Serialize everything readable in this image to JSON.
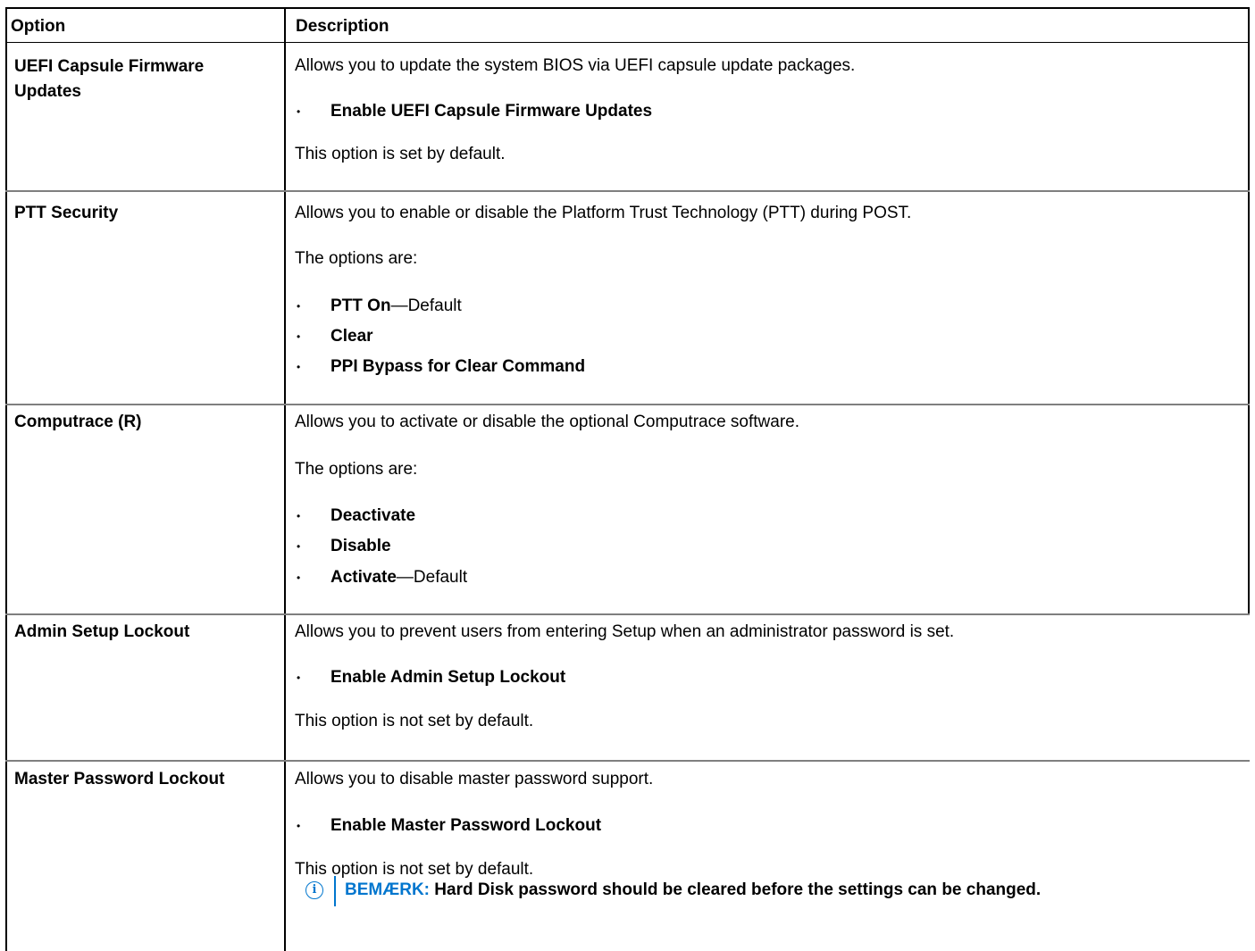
{
  "colors": {
    "note_accent": "#0076ce",
    "row_divider": "#7f7f7f"
  },
  "header": {
    "option": "Option",
    "description": "Description"
  },
  "rows": [
    {
      "option": "UEFI Capsule Firmware Updates",
      "lines": [
        "Allows you to update the system BIOS via UEFI capsule update packages.",
        "This option is set by default."
      ],
      "bullets": [
        {
          "bold": "Enable UEFI Capsule Firmware Updates",
          "rest": ""
        }
      ]
    },
    {
      "option": "PTT Security",
      "lines": [
        "Allows you to enable or disable the Platform Trust Technology (PTT) during POST.",
        "The options are:"
      ],
      "bullets": [
        {
          "bold": "PTT On",
          "rest": "—Default"
        },
        {
          "bold": "Clear",
          "rest": ""
        },
        {
          "bold": "PPI Bypass for Clear Command",
          "rest": ""
        }
      ]
    },
    {
      "option": "Computrace (R)",
      "lines": [
        "Allows you to activate or disable the optional Computrace software.",
        "The options are:"
      ],
      "bullets": [
        {
          "bold": "Deactivate",
          "rest": ""
        },
        {
          "bold": "Disable",
          "rest": ""
        },
        {
          "bold": "Activate",
          "rest": "—Default"
        }
      ]
    },
    {
      "option": "Admin Setup Lockout",
      "lines": [
        "Allows you to prevent users from entering Setup when an administrator password is set.",
        "This option is not set by default."
      ],
      "bullets": [
        {
          "bold": "Enable Admin Setup Lockout",
          "rest": ""
        }
      ]
    },
    {
      "option": "Master Password Lockout",
      "lines": [
        "Allows you to disable master password support.",
        "This option is not set by default."
      ],
      "bullets": [
        {
          "bold": "Enable Master Password Lockout",
          "rest": ""
        }
      ],
      "note": {
        "icon": "info-icon",
        "label": "BEMÆRK:",
        "text": " Hard Disk password should be cleared before the settings can be changed."
      }
    }
  ],
  "bullet_char": "•"
}
